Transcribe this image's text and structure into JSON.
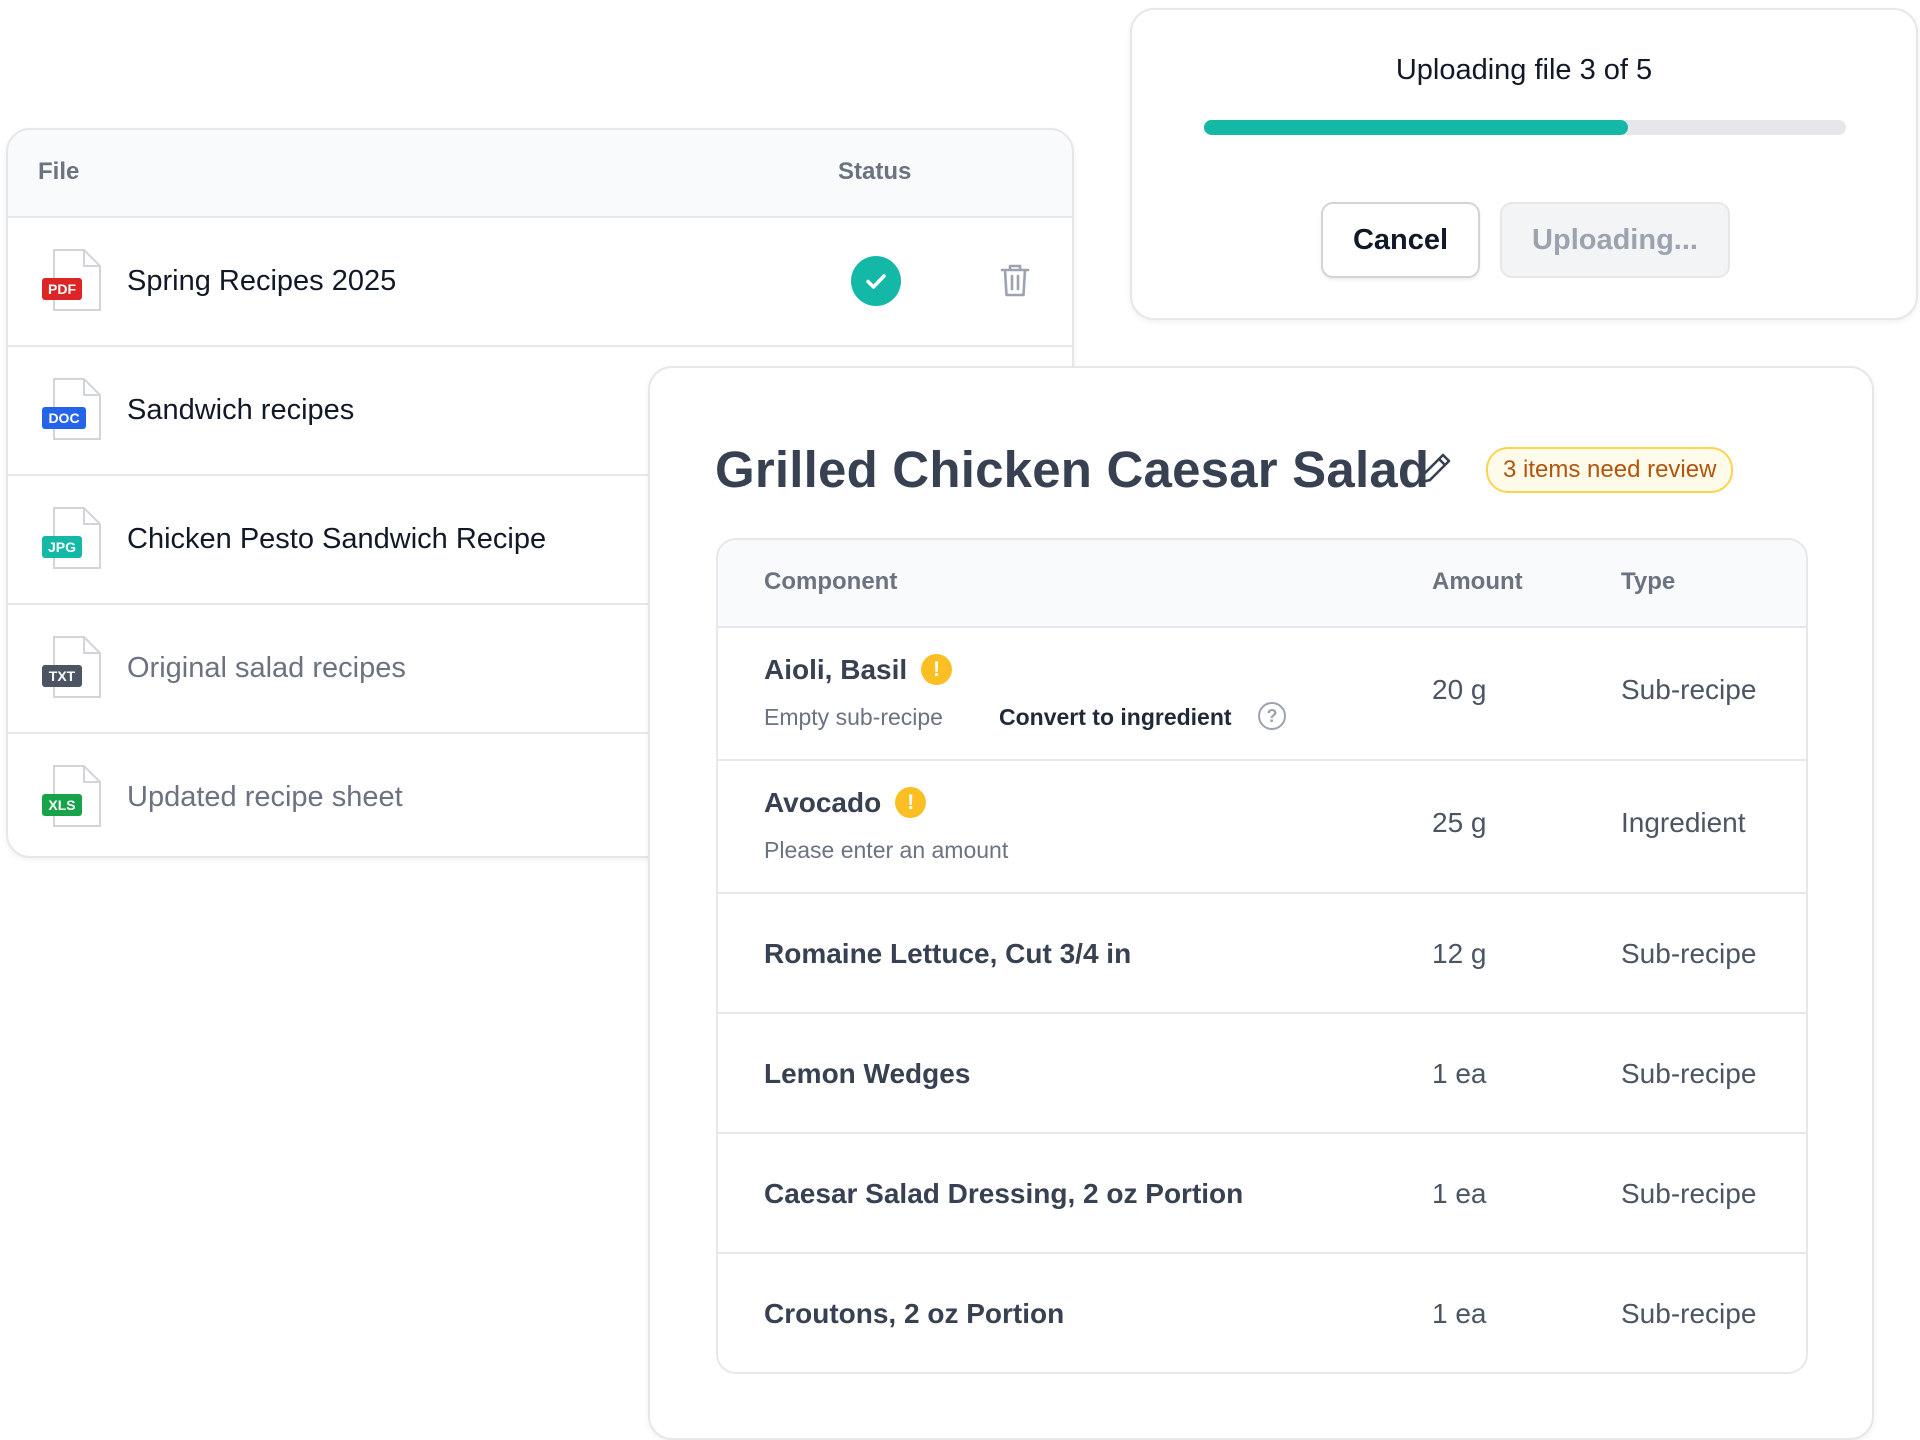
{
  "file_list": {
    "header": {
      "file": "File",
      "status": "Status"
    },
    "files": [
      {
        "type_label": "PDF",
        "name": "Spring Recipes 2025",
        "status": "done",
        "badge_color": "#dc2626"
      },
      {
        "type_label": "DOC",
        "name": "Sandwich recipes",
        "status": "",
        "badge_color": "#2563eb"
      },
      {
        "type_label": "JPG",
        "name": "Chicken Pesto Sandwich Recipe",
        "status": "",
        "badge_color": "#14b8a6"
      },
      {
        "type_label": "TXT",
        "name": "Original salad recipes",
        "status": "",
        "badge_color": "#4b5563"
      },
      {
        "type_label": "XLS",
        "name": "Updated recipe sheet",
        "status": "",
        "badge_color": "#16a34a"
      }
    ]
  },
  "upload": {
    "title": "Uploading file 3 of 5",
    "progress": 0.66,
    "cancel_label": "Cancel",
    "uploading_label": "Uploading..."
  },
  "recipe": {
    "title": "Grilled Chicken Caesar Salad",
    "review_badge": "3 items need review",
    "columns": {
      "component": "Component",
      "amount": "Amount",
      "type": "Type"
    },
    "rows": [
      {
        "name": "Aioli, Basil",
        "warning": true,
        "note": "Empty sub-recipe",
        "action": "Convert to ingredient",
        "amount": "20 g",
        "type": "Sub-recipe"
      },
      {
        "name": "Avocado",
        "warning": true,
        "note": "Please enter an amount",
        "amount": "25 g",
        "type": "Ingredient"
      },
      {
        "name": "Romaine Lettuce, Cut 3/4 in",
        "amount": "12 g",
        "type": "Sub-recipe"
      },
      {
        "name": "Lemon Wedges",
        "amount": "1 ea",
        "type": "Sub-recipe"
      },
      {
        "name": "Caesar Salad Dressing, 2 oz Portion",
        "amount": "1 ea",
        "type": "Sub-recipe"
      },
      {
        "name": "Croutons, 2 oz Portion",
        "amount": "1 ea",
        "type": "Sub-recipe"
      }
    ]
  },
  "colors": {
    "accent_teal": "#14b8a6",
    "warning_amber": "#fbbf24",
    "badge_border": "#fcd34d",
    "badge_text": "#b45309"
  }
}
